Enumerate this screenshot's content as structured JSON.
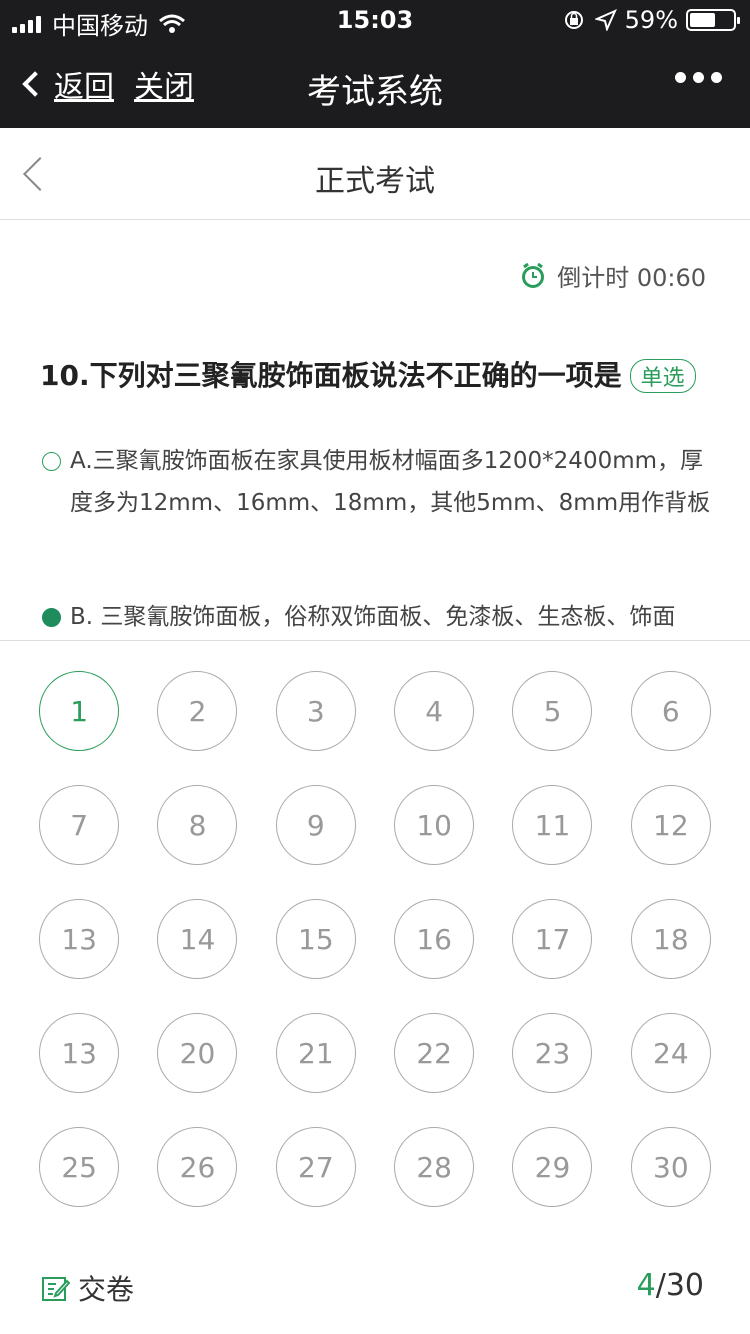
{
  "status": {
    "carrier": "中国移动",
    "time": "15:03",
    "battery": "59%",
    "battery_level": 0.59
  },
  "nav": {
    "back_label": "返回",
    "close_label": "关闭",
    "title": "考试系统"
  },
  "page": {
    "title": "正式考试"
  },
  "timer": {
    "label": "倒计时 00:60"
  },
  "question": {
    "text": "10.下列对三聚氰胺饰面板说法不正确的一项是",
    "tag": "单选",
    "options": [
      {
        "text": "A.三聚氰胺饰面板在家具使用板材幅面多1200*2400mm，厚度多为12mm、16mm、18mm，其他5mm、8mm用作背板",
        "selected": false
      },
      {
        "text": "B. 三聚氰胺饰面板，俗称双饰面板、免漆板、生态板、饰面",
        "selected": true
      }
    ]
  },
  "sheet": {
    "numbers": [
      "1",
      "2",
      "3",
      "4",
      "5",
      "6",
      "7",
      "8",
      "9",
      "10",
      "11",
      "12",
      "13",
      "14",
      "15",
      "16",
      "17",
      "18",
      "13",
      "20",
      "21",
      "22",
      "23",
      "24",
      "25",
      "26",
      "27",
      "28",
      "29",
      "30"
    ],
    "active_index": 0
  },
  "footer": {
    "submit_label": "交卷",
    "current": "4",
    "separator": "/",
    "total": "30"
  },
  "colors": {
    "accent": "#2a9d5c",
    "dark_bar": "#1c1c1e"
  }
}
